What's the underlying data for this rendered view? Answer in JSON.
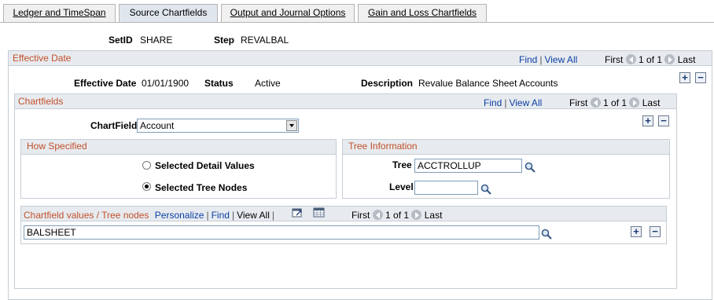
{
  "tabs": [
    {
      "label": "Ledger and TimeSpan",
      "active": false
    },
    {
      "label": "Source Chartfields",
      "active": true
    },
    {
      "label": "Output and Journal Options",
      "active": false
    },
    {
      "label": "Gain and Loss Chartfields",
      "active": false
    }
  ],
  "header": {
    "setid_label": "SetID",
    "setid_value": "SHARE",
    "step_label": "Step",
    "step_value": "REVALBAL"
  },
  "effective_date": {
    "title": "Effective Date",
    "find": "Find",
    "view_all": "View All",
    "first": "First",
    "counter": "1 of 1",
    "last": "Last",
    "date_label": "Effective Date",
    "date_value": "01/01/1900",
    "status_label": "Status",
    "status_value": "Active",
    "desc_label": "Description",
    "desc_value": "Revalue Balance Sheet Accounts"
  },
  "chartfields": {
    "title": "Chartfields",
    "find": "Find",
    "view_all": "View All",
    "first": "First",
    "counter": "1 of 1",
    "last": "Last",
    "chartfield_label": "ChartField",
    "chartfield_value": "Account"
  },
  "how_specified": {
    "title": "How Specified",
    "option1": "Selected Detail Values",
    "option2": "Selected Tree Nodes",
    "selected": 2
  },
  "tree_info": {
    "title": "Tree Information",
    "tree_label": "Tree",
    "tree_value": "ACCTROLLUP",
    "level_label": "Level",
    "level_value": ""
  },
  "values_grid": {
    "title": "Chartfield values / Tree nodes",
    "personalize": "Personalize",
    "find": "Find",
    "view_all": "View All",
    "first": "First",
    "counter": "1 of 1",
    "last": "Last",
    "row_value": "BALSHEET"
  },
  "colors": {
    "section_title": "#c2502b",
    "link": "#0b3fa6",
    "section_header_bg": "#e7ebef"
  }
}
